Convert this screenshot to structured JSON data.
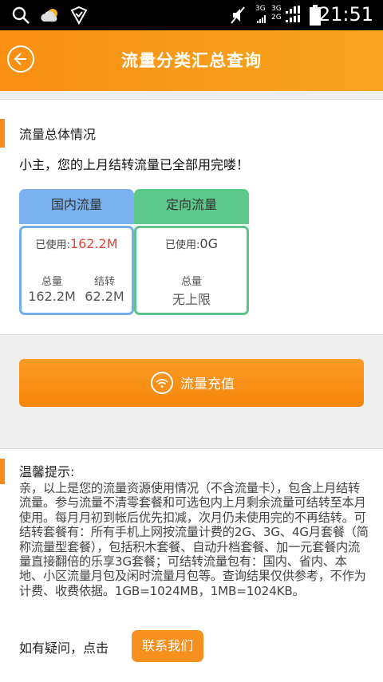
{
  "status_bar": {
    "net_top": "3G",
    "net_bottom": "2G",
    "net_top2": "3G",
    "time": "21:51",
    "icons": [
      "search-icon",
      "weather-cloud-icon",
      "shield-check-icon",
      "mute-icon",
      "signal-icon",
      "battery-icon"
    ]
  },
  "header": {
    "title": "流量分类汇总查询",
    "back_icon": "back-arrow-icon"
  },
  "overview": {
    "title": "流量总体情况",
    "message": "小主，您的上月结转流量已全部用完喽！",
    "domestic": {
      "label": "国内流量",
      "used_label": "已使用:",
      "used_value": "162.2M",
      "total_label": "总量",
      "total_value": "162.2M",
      "carry_label": "结转",
      "carry_value": "62.2M"
    },
    "directed": {
      "label": "定向流量",
      "used_label": "已使用:",
      "used_value": "0G",
      "total_label": "总量",
      "total_value": "无上限"
    }
  },
  "recharge": {
    "label": "流量充值",
    "icon": "wifi-icon"
  },
  "tips": {
    "title": "温馨提示:",
    "body": "亲，以上是您的流量资源使用情况（不含流量卡），包含上月结转流量。参与流量不清零套餐和可选包内上月剩余流量可结转至本月使用。每月月初到帐后优先扣减，次月仍未使用完的不再结转。可结转套餐有：所有手机上网按流量计费的2G、3G、4G月套餐（简称流量型套餐），包括积木套餐、自动升档套餐、加一元套餐内流量直接翻倍的乐享3G套餐；可结转流量包有：国内、省内、本地、小区流量月包及闲时流量月包等。查询结果仅供参考，不作为计费、收费依据。1GB=1024MB，1MB=1024KB。",
    "ask": "如有疑问，点击",
    "contact": "联系我们"
  },
  "colors": {
    "accent": "#f68d18",
    "blue_head": "#7ab2f0",
    "blue_border": "#74aeea",
    "green_head": "#5cc98a",
    "green_border": "#5ec28b",
    "used_red": "#e0463b"
  }
}
